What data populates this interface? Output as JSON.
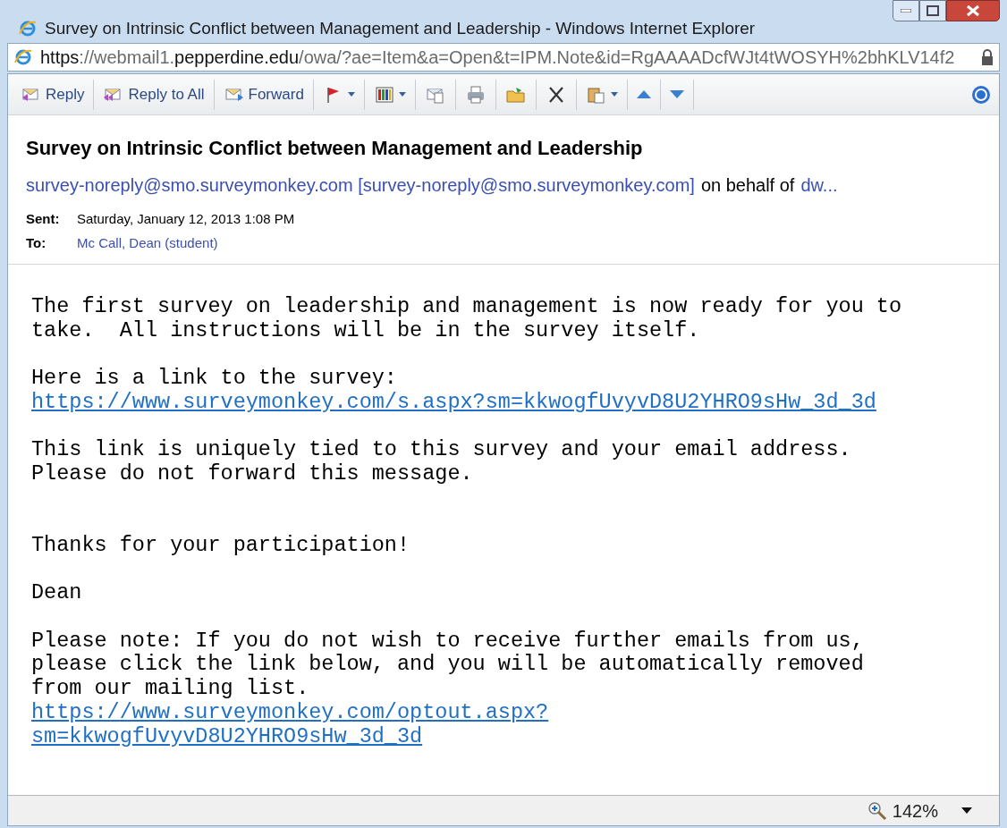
{
  "window": {
    "title": "Survey on Intrinsic Conflict between Management and Leadership - Windows Internet Explorer"
  },
  "address_bar": {
    "segments": [
      {
        "text": "https",
        "kind": "dark"
      },
      {
        "text": "://webmail1.",
        "kind": "dim"
      },
      {
        "text": "pepperdine.edu",
        "kind": "dark"
      },
      {
        "text": "/owa/?ae=Item&a=Open&t=IPM.Note&id=RgAAAADcfWJt4tWOSYH%2bhKLV14f2",
        "kind": "dim"
      }
    ]
  },
  "toolbar": [
    {
      "kind": "labeled",
      "label": "Reply",
      "dropdown": false
    },
    {
      "kind": "labeled",
      "label": "Reply to All",
      "dropdown": false
    },
    {
      "kind": "labeled",
      "label": "Forward",
      "dropdown": false
    },
    {
      "kind": "icon",
      "dropdown": true
    },
    {
      "kind": "icon",
      "dropdown": true
    },
    {
      "kind": "icon",
      "dropdown": false
    },
    {
      "kind": "icon",
      "dropdown": false
    },
    {
      "kind": "icon",
      "dropdown": false
    },
    {
      "kind": "icon",
      "dropdown": false
    },
    {
      "kind": "icon",
      "dropdown": true
    },
    {
      "kind": "icon",
      "dropdown": false
    },
    {
      "kind": "icon",
      "dropdown": false
    }
  ],
  "message": {
    "subject": "Survey on Intrinsic Conflict between Management and Leadership",
    "from": [
      {
        "text": "survey-noreply@smo.surveymonkey.com [survey-noreply@smo.surveymonkey.com]",
        "kind": "link"
      },
      {
        "text": "on behalf of",
        "kind": "text"
      },
      {
        "text": "dw...",
        "kind": "link"
      }
    ],
    "fields": [
      {
        "label": "Sent:",
        "value": "Saturday, January 12, 2013 1:08 PM",
        "kind": "text"
      },
      {
        "label": "To:",
        "value": "Mc Call, Dean (student)",
        "kind": "link"
      }
    ],
    "body": [
      {
        "extra_space": false,
        "lines": [
          {
            "text": "The first survey on leadership and management is now ready for you to",
            "kind": "text"
          },
          {
            "text": "take.  All instructions will be in the survey itself.",
            "kind": "text"
          }
        ]
      },
      {
        "extra_space": false,
        "lines": [
          {
            "text": "Here is a link to the survey:",
            "kind": "text"
          },
          {
            "text": "https://www.surveymonkey.com/s.aspx?sm=kkwogfUvyvD8U2YHRO9sHw_3d_3d",
            "kind": "link"
          }
        ]
      },
      {
        "extra_space": false,
        "lines": [
          {
            "text": "This link is uniquely tied to this survey and your email address.",
            "kind": "text"
          },
          {
            "text": "Please do not forward this message.",
            "kind": "text"
          }
        ]
      },
      {
        "extra_space": true,
        "lines": [
          {
            "text": "Thanks for your participation!",
            "kind": "text"
          }
        ]
      },
      {
        "extra_space": false,
        "lines": [
          {
            "text": "Dean",
            "kind": "text"
          }
        ]
      },
      {
        "extra_space": false,
        "lines": [
          {
            "text": "Please note: If you do not wish to receive further emails from us,",
            "kind": "text"
          },
          {
            "text": "please click the link below, and you will be automatically removed",
            "kind": "text"
          },
          {
            "text": "from our mailing list.",
            "kind": "text"
          },
          {
            "text": "https://www.surveymonkey.com/optout.aspx?",
            "kind": "link"
          },
          {
            "text": "sm=kkwogfUvyvD8U2YHRO9sHw_3d_3d",
            "kind": "link"
          }
        ]
      }
    ]
  },
  "status_bar": {
    "zoom": "142%"
  }
}
